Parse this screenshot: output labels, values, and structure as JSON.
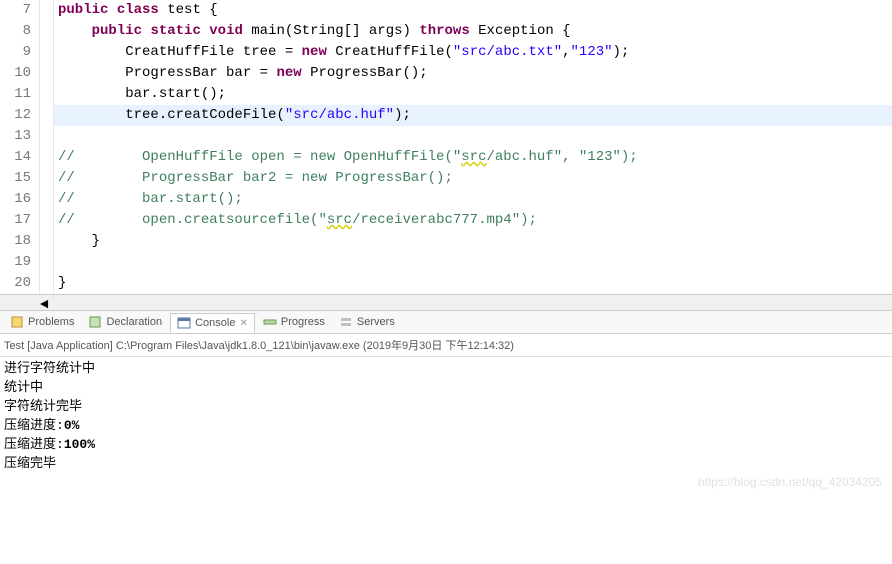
{
  "editor": {
    "lines": [
      {
        "n": 7,
        "hl": false,
        "tokens": [
          {
            "t": "public",
            "c": "kw"
          },
          {
            "t": " ",
            "c": ""
          },
          {
            "t": "class",
            "c": "kw"
          },
          {
            "t": " test {",
            "c": "cls"
          }
        ]
      },
      {
        "n": 8,
        "hl": false,
        "indent": 1,
        "tokens": [
          {
            "t": "public",
            "c": "kw"
          },
          {
            "t": " ",
            "c": ""
          },
          {
            "t": "static",
            "c": "kw"
          },
          {
            "t": " ",
            "c": ""
          },
          {
            "t": "void",
            "c": "kw"
          },
          {
            "t": " main(String[] args) ",
            "c": "cls"
          },
          {
            "t": "throws",
            "c": "kw"
          },
          {
            "t": " Exception {",
            "c": "cls"
          }
        ]
      },
      {
        "n": 9,
        "hl": false,
        "indent": 2,
        "tokens": [
          {
            "t": "CreatHuffFile tree = ",
            "c": "cls"
          },
          {
            "t": "new",
            "c": "kw"
          },
          {
            "t": " CreatHuffFile(",
            "c": "cls"
          },
          {
            "t": "\"src/abc.txt\"",
            "c": "str"
          },
          {
            "t": ",",
            "c": "cls"
          },
          {
            "t": "\"123\"",
            "c": "str"
          },
          {
            "t": ");",
            "c": "cls"
          }
        ]
      },
      {
        "n": 10,
        "hl": false,
        "indent": 2,
        "tokens": [
          {
            "t": "ProgressBar bar = ",
            "c": "cls"
          },
          {
            "t": "new",
            "c": "kw"
          },
          {
            "t": " ProgressBar();",
            "c": "cls"
          }
        ]
      },
      {
        "n": 11,
        "hl": false,
        "indent": 2,
        "tokens": [
          {
            "t": "bar.start();",
            "c": "cls"
          }
        ]
      },
      {
        "n": 12,
        "hl": true,
        "indent": 2,
        "tokens": [
          {
            "t": "tree.creatCodeFile(",
            "c": "cls"
          },
          {
            "t": "\"src/abc.huf\"",
            "c": "str"
          },
          {
            "t": ");",
            "c": "cls"
          }
        ]
      },
      {
        "n": 13,
        "hl": false,
        "indent": 0,
        "tokens": []
      },
      {
        "n": 14,
        "hl": false,
        "indent": 0,
        "tokens": [
          {
            "t": "//        OpenHuffFile open = new OpenHuffFile(\"",
            "c": "cmt"
          },
          {
            "t": "src",
            "c": "cmt squig"
          },
          {
            "t": "/abc.huf\", \"123\");",
            "c": "cmt"
          }
        ]
      },
      {
        "n": 15,
        "hl": false,
        "indent": 0,
        "tokens": [
          {
            "t": "//        ProgressBar bar2 = new ProgressBar();",
            "c": "cmt"
          }
        ]
      },
      {
        "n": 16,
        "hl": false,
        "indent": 0,
        "tokens": [
          {
            "t": "//        bar.start();",
            "c": "cmt"
          }
        ]
      },
      {
        "n": 17,
        "hl": false,
        "indent": 0,
        "tokens": [
          {
            "t": "//        open.creatsourcefile(\"",
            "c": "cmt"
          },
          {
            "t": "src",
            "c": "cmt squig"
          },
          {
            "t": "/receiverabc777.mp4\");",
            "c": "cmt"
          }
        ]
      },
      {
        "n": 18,
        "hl": false,
        "indent": 1,
        "tokens": [
          {
            "t": "}",
            "c": "cls"
          }
        ]
      },
      {
        "n": 19,
        "hl": false,
        "indent": 0,
        "tokens": []
      },
      {
        "n": 20,
        "hl": false,
        "indent": 0,
        "tokens": [
          {
            "t": "}",
            "c": "cls"
          }
        ]
      }
    ]
  },
  "tabs": {
    "items": [
      {
        "label": "Problems",
        "active": false,
        "icon": "problems-icon"
      },
      {
        "label": "Declaration",
        "active": false,
        "icon": "declaration-icon"
      },
      {
        "label": "Console",
        "active": true,
        "icon": "console-icon"
      },
      {
        "label": "Progress",
        "active": false,
        "icon": "progress-icon"
      },
      {
        "label": "Servers",
        "active": false,
        "icon": "servers-icon"
      }
    ],
    "close_x": "✕"
  },
  "console": {
    "header": "Test [Java Application] C:\\Program Files\\Java\\jdk1.8.0_121\\bin\\javaw.exe (2019年9月30日 下午12:14:32)",
    "lines": [
      {
        "text": "进行字符统计中",
        "bold": false
      },
      {
        "text": "统计中",
        "bold": false
      },
      {
        "text": "字符统计完毕",
        "bold": false
      },
      {
        "text_pre": "压缩进度:",
        "text_val": "0%",
        "bold": false
      },
      {
        "text_pre": "压缩进度:",
        "text_val": "100%",
        "bold": false
      },
      {
        "text": "压缩完毕",
        "bold": false
      }
    ],
    "watermark": "https://blog.csdn.net/qq_42034205"
  }
}
